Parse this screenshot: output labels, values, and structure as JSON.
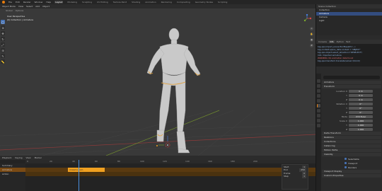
{
  "menubar": {
    "items": [
      "File",
      "Edit",
      "Render",
      "Window",
      "Help"
    ],
    "workspaces": [
      "Layout",
      "Modeling",
      "Sculpting",
      "UV Editing",
      "Texture Paint",
      "Shading",
      "Animation",
      "Rendering",
      "Compositing",
      "Geometry Nodes",
      "Scripting"
    ],
    "active_workspace": "Layout"
  },
  "viewport": {
    "header_items": [
      "Object Mode",
      "View",
      "Select",
      "Add",
      "Object"
    ],
    "tool_items": [
      "Global",
      "Options"
    ],
    "overlay_line1": "User Perspective",
    "overlay_line2": "(0) Collection | Armature",
    "nav_icons": [
      "zoom-icon",
      "pan-icon",
      "camera-icon",
      "grid-icon"
    ]
  },
  "timeline": {
    "header_items": [
      "Playback",
      "Keying",
      "View",
      "Marker"
    ],
    "channels": [
      "Summary",
      "Armature",
      "Action"
    ],
    "strip_label": "mixamo.com",
    "ruler_ticks": [
      "0",
      "20",
      "40",
      "60",
      "80",
      "100",
      "120",
      "140",
      "160",
      "180",
      "200",
      "220",
      "240"
    ],
    "popup": [
      {
        "label": "Start",
        "value": "1"
      },
      {
        "label": "End",
        "value": "250"
      },
      {
        "label": "Frame",
        "value": "0"
      },
      {
        "label": "Step",
        "value": "1"
      }
    ]
  },
  "outliner": {
    "header": "Scene Collection",
    "rows": [
      "Collection",
      "Armature",
      "Camera",
      "Light"
    ],
    "selected_index": 1
  },
  "info": {
    "tabs": [
      "Console",
      "Info",
      "Python",
      "Text"
    ],
    "active_tab": "Info",
    "lines": [
      "bpy.ops.import_scene.fbx(filepath=...)",
      "bpy.context.space_data.context = 'OBJECT'",
      "bpy.ops.object.select_all(action='DESELECT')",
      "Info: imported armature",
      "WARNING: No animation data found",
      "bpy.ops.transform.translate(value=(0,0,0))"
    ],
    "error_index": 4
  },
  "properties": {
    "search_placeholder": "",
    "object_name": "Armature",
    "sections": {
      "transform": "Transform",
      "delta": "Delta Transform",
      "relations": "Relations",
      "collections": "Collections",
      "instancing": "Instancing",
      "motion_paths": "Motion Paths",
      "visibility": "Visibility",
      "viewport_display": "Viewport Display",
      "custom_props": "Custom Properties"
    },
    "location_label": "Location X",
    "location": [
      "0 m",
      "0 m",
      "0 m"
    ],
    "rotation_label": "Rotation X",
    "rotation": [
      "0°",
      "0°",
      "0°"
    ],
    "mode_label": "Mode",
    "mode_value": "XYZ Euler",
    "scale_label": "Scale X",
    "scale": [
      "1.000",
      "1.000",
      "1.000"
    ],
    "axis_labels": [
      "Y",
      "Z"
    ],
    "checks": [
      "Selectable",
      "Viewport",
      "Renders"
    ]
  }
}
